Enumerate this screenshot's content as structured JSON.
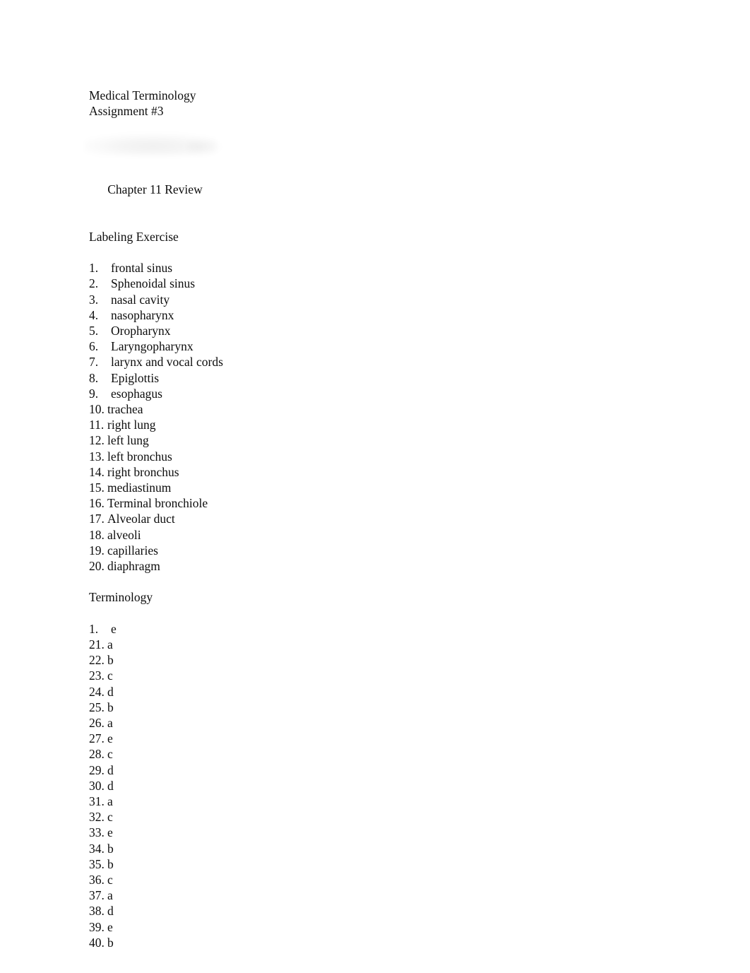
{
  "document": {
    "title_lines": [
      "Medical Terminology",
      "Assignment #3"
    ],
    "chapter_heading": "Chapter 11 Review",
    "sections": [
      {
        "heading": "Labeling Exercise",
        "items": [
          {
            "number": "1.",
            "label": "frontal sinus"
          },
          {
            "number": "2.",
            "label": "Sphenoidal sinus"
          },
          {
            "number": "3.",
            "label": "nasal cavity"
          },
          {
            "number": "4.",
            "label": "nasopharynx"
          },
          {
            "number": "5.",
            "label": "Oropharynx"
          },
          {
            "number": "6.",
            "label": "Laryngopharynx"
          },
          {
            "number": "7.",
            "label": "larynx and vocal cords"
          },
          {
            "number": "8.",
            "label": "Epiglottis"
          },
          {
            "number": "9.",
            "label": "esophagus"
          },
          {
            "number": "10.",
            "label": "trachea"
          },
          {
            "number": "11.",
            "label": "right lung"
          },
          {
            "number": "12.",
            "label": "left lung"
          },
          {
            "number": "13.",
            "label": "left bronchus"
          },
          {
            "number": "14.",
            "label": "right bronchus"
          },
          {
            "number": "15.",
            "label": "mediastinum"
          },
          {
            "number": "16.",
            "label": "Terminal bronchiole"
          },
          {
            "number": "17.",
            "label": "Alveolar duct"
          },
          {
            "number": "18.",
            "label": "alveoli"
          },
          {
            "number": "19.",
            "label": "capillaries"
          },
          {
            "number": "20.",
            "label": "diaphragm"
          }
        ]
      },
      {
        "heading": "Terminology",
        "items": [
          {
            "number": "1.",
            "label": "e"
          },
          {
            "number": "21.",
            "label": "a"
          },
          {
            "number": "22.",
            "label": "b"
          },
          {
            "number": "23.",
            "label": "c"
          },
          {
            "number": "24.",
            "label": "d"
          },
          {
            "number": "25.",
            "label": "b"
          },
          {
            "number": "26.",
            "label": "a"
          },
          {
            "number": "27.",
            "label": "e"
          },
          {
            "number": "28.",
            "label": "c"
          },
          {
            "number": "29.",
            "label": "d"
          },
          {
            "number": "30.",
            "label": "d"
          },
          {
            "number": "31.",
            "label": "a"
          },
          {
            "number": "32.",
            "label": "c"
          },
          {
            "number": "33.",
            "label": "e"
          },
          {
            "number": "34.",
            "label": "b"
          },
          {
            "number": "35.",
            "label": "b"
          },
          {
            "number": "36.",
            "label": "c"
          },
          {
            "number": "37.",
            "label": "a"
          },
          {
            "number": "38.",
            "label": "d"
          },
          {
            "number": "39.",
            "label": "e"
          },
          {
            "number": "40.",
            "label": "b"
          }
        ]
      }
    ],
    "colors": {
      "page_background": "#ffffff",
      "text": "#0d0d0d"
    }
  }
}
